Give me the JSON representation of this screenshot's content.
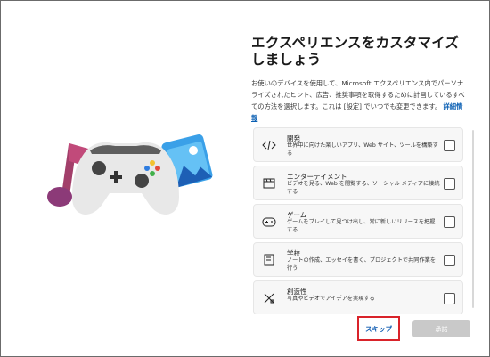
{
  "header": {
    "title": "エクスペリエンスをカスタマイズしましょう"
  },
  "description": {
    "text": "お使いのデバイスを使用して、Microsoft エクスペリエンス内でパーソナライズされたヒント、広告、推奨事項を取得するために計画しているすべての方法を選択します。これは [設定] でいつでも変更できます。",
    "link": "詳細情報"
  },
  "options": [
    {
      "title": "開発",
      "subtitle": "世界中に向けた楽しいアプリ、Web サイト、ツールを構築する",
      "icon": "code-icon"
    },
    {
      "title": "エンターテイメント",
      "subtitle": "ビデオを見る、Web を閲覧する、ソーシャル メディアに接続する",
      "icon": "clapperboard-icon"
    },
    {
      "title": "ゲーム",
      "subtitle": "ゲームをプレイして見つけ出し、常に新しいリリースを把握する",
      "icon": "gamepad-icon"
    },
    {
      "title": "学校",
      "subtitle": "ノートの作成、エッセイを書く、プロジェクトで共同作業を行う",
      "icon": "notebook-icon"
    },
    {
      "title": "創造性",
      "subtitle": "写真やビデオでアイデアを実現する",
      "icon": "pen-ruler-icon"
    }
  ],
  "buttons": {
    "skip": "スキップ",
    "accept": "承諾"
  },
  "colors": {
    "highlight": "#d9232a",
    "link": "#0a5fb3",
    "disabled_button": "#c9c9c9"
  }
}
